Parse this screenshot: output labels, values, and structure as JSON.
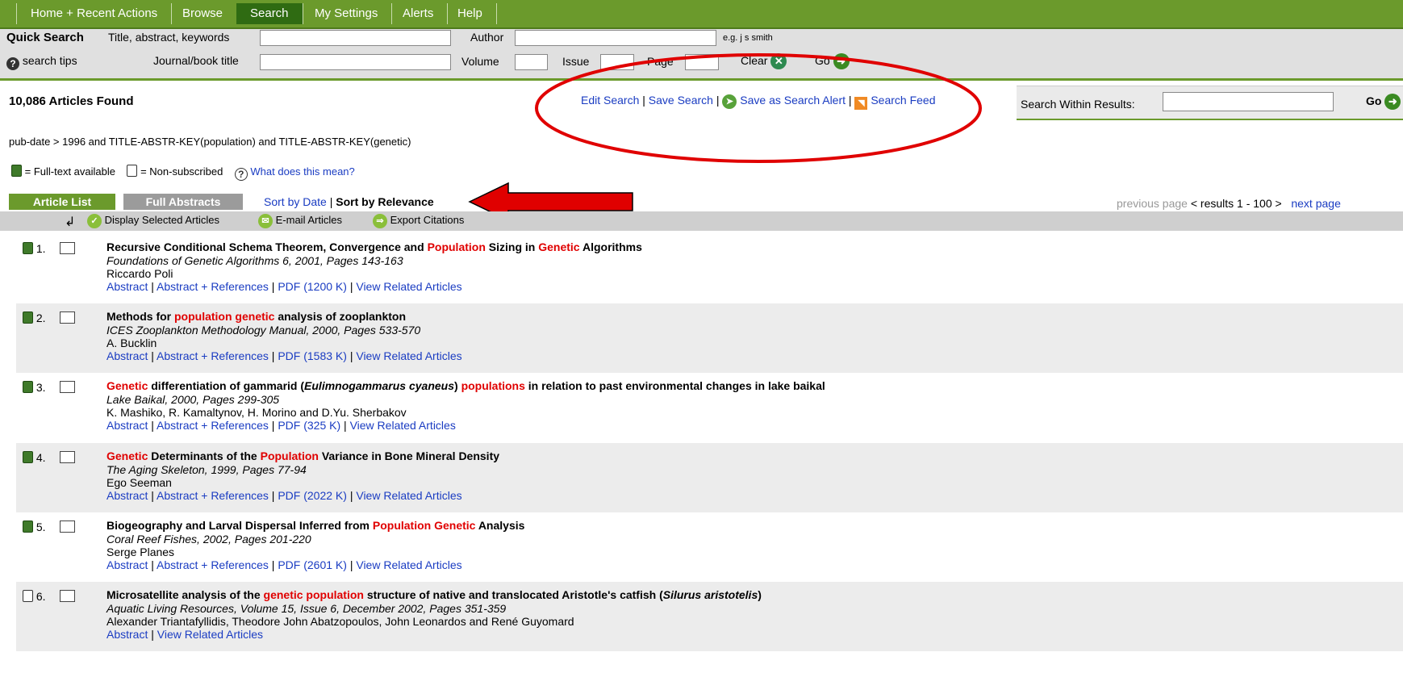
{
  "nav": {
    "tabs": [
      "Home + Recent Actions",
      "Browse",
      "Search",
      "My Settings",
      "Alerts",
      "Help"
    ],
    "active": "Search"
  },
  "quick_search": {
    "title": "Quick Search",
    "title_abstract_label": "Title, abstract, keywords",
    "author_label": "Author",
    "author_hint": "e.g. j s smith",
    "search_tips": "search tips",
    "journal_label": "Journal/book title",
    "volume_label": "Volume",
    "issue_label": "Issue",
    "page_label": "Page",
    "clear_label": "Clear",
    "go_label": "Go"
  },
  "results_header": {
    "count": "10,086 Articles Found",
    "edit_search": "Edit Search",
    "save_search": "Save Search",
    "save_alert": "Save as Search Alert",
    "search_feed": "Search Feed",
    "search_within": "Search Within Results:",
    "go_label": "Go"
  },
  "query": "pub-date > 1996 and TITLE-ABSTR-KEY(population) and TITLE-ABSTR-KEY(genetic)",
  "legend": {
    "full_text": "= Full-text available",
    "non_sub": "= Non-subscribed",
    "what": "What does this mean?"
  },
  "list_tabs": {
    "article_list": "Article List",
    "full_abstracts": "Full Abstracts",
    "sort_by_date": "Sort by Date",
    "sort_by_relevance": "Sort by Relevance",
    "previous_page": "previous page",
    "results_range": "< results 1 - 100 >",
    "next_page": "next page"
  },
  "toolbar": {
    "display_selected": "Display Selected Articles",
    "email": "E-mail Articles",
    "export": "Export Citations"
  },
  "colors": {
    "nav_green": "#6b9a2c",
    "active_tab": "#2f6b12",
    "link": "#1a3cc2",
    "highlight": "#e00000"
  },
  "results": [
    {
      "num": "1.",
      "full_text": true,
      "title": [
        [
          "Recursive Conditional Schema Theorem, Convergence and ",
          ""
        ],
        [
          "Population",
          "red"
        ],
        [
          " Sizing in ",
          ""
        ],
        [
          "Genetic",
          "red"
        ],
        [
          " Algorithms",
          ""
        ]
      ],
      "source": "Foundations of Genetic Algorithms 6, 2001, Pages 143-163",
      "authors": "Riccardo Poli",
      "links": [
        "Abstract",
        "Abstract + References",
        "PDF (1200 K)",
        "View Related Articles"
      ]
    },
    {
      "num": "2.",
      "full_text": true,
      "title": [
        [
          "Methods for ",
          ""
        ],
        [
          "population genetic",
          "red"
        ],
        [
          " analysis of zooplankton",
          ""
        ]
      ],
      "source": "ICES Zooplankton Methodology Manual, 2000, Pages 533-570",
      "authors": "A. Bucklin",
      "links": [
        "Abstract",
        "Abstract + References",
        "PDF (1583 K)",
        "View Related Articles"
      ]
    },
    {
      "num": "3.",
      "full_text": true,
      "title": [
        [
          "Genetic",
          "red"
        ],
        [
          " differentiation of gammarid (",
          ""
        ],
        [
          "Eulimnogammarus cyaneus",
          "italic"
        ],
        [
          ") ",
          ""
        ],
        [
          "populations",
          "red"
        ],
        [
          " in relation to past environmental changes in lake baikal",
          ""
        ]
      ],
      "source": "Lake Baikal, 2000, Pages 299-305",
      "authors": "K. Mashiko, R. Kamaltynov, H. Morino and D.Yu. Sherbakov",
      "links": [
        "Abstract",
        "Abstract + References",
        "PDF (325 K)",
        "View Related Articles"
      ]
    },
    {
      "num": "4.",
      "full_text": true,
      "title": [
        [
          "Genetic",
          "red"
        ],
        [
          " Determinants of the ",
          ""
        ],
        [
          "Population",
          "red"
        ],
        [
          " Variance in Bone Mineral Density",
          ""
        ]
      ],
      "source": "The Aging Skeleton, 1999, Pages 77-94",
      "authors": "Ego Seeman",
      "links": [
        "Abstract",
        "Abstract + References",
        "PDF (2022 K)",
        "View Related Articles"
      ]
    },
    {
      "num": "5.",
      "full_text": true,
      "title": [
        [
          "Biogeography and Larval Dispersal Inferred from ",
          ""
        ],
        [
          "Population Genetic",
          "red"
        ],
        [
          " Analysis",
          ""
        ]
      ],
      "source": "Coral Reef Fishes, 2002, Pages 201-220",
      "authors": "Serge Planes",
      "links": [
        "Abstract",
        "Abstract + References",
        "PDF (2601 K)",
        "View Related Articles"
      ]
    },
    {
      "num": "6.",
      "full_text": false,
      "title": [
        [
          "Microsatellite analysis of the ",
          ""
        ],
        [
          "genetic population",
          "red"
        ],
        [
          " structure of native and translocated Aristotle's catfish (",
          ""
        ],
        [
          "Silurus aristotelis",
          "italic"
        ],
        [
          ")",
          ""
        ]
      ],
      "source": "Aquatic Living Resources, Volume 15, Issue 6, December 2002, Pages 351-359",
      "authors": "Alexander Triantafyllidis, Theodore John Abatzopoulos, John Leonardos and René Guyomard",
      "links": [
        "Abstract",
        "View Related Articles"
      ]
    }
  ]
}
